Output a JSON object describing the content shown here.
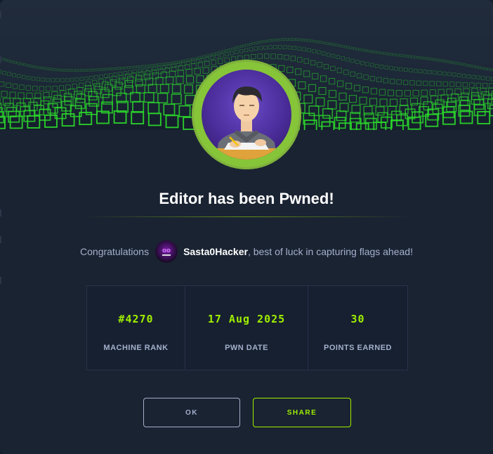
{
  "dialog": {
    "title": "Editor has been Pwned!",
    "congrats_prefix": "Congratulations",
    "username": "Sasta0Hacker",
    "congrats_suffix": ", best of luck in capturing flags ahead!"
  },
  "stats": [
    {
      "value": "#4270",
      "label": "MACHINE RANK"
    },
    {
      "value": "17 Aug 2025",
      "label": "PWN DATE"
    },
    {
      "value": "30",
      "label": "POINTS EARNED"
    }
  ],
  "buttons": {
    "ok": "OK",
    "share": "SHARE"
  },
  "colors": {
    "accent": "#9fef00",
    "background": "#1a2332",
    "muted_text": "#a4b1cd"
  }
}
